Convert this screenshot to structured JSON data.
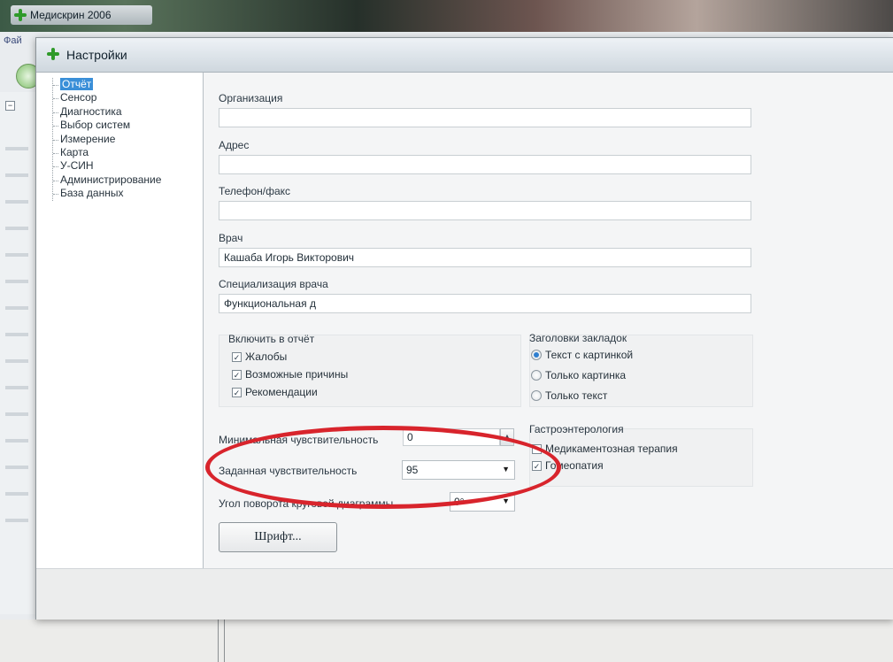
{
  "app": {
    "title": "Медискрин 2006",
    "menu_first": "Фай"
  },
  "dialog": {
    "title": "Настройки"
  },
  "nav": {
    "items": [
      {
        "label": "Отчёт",
        "selected": true
      },
      {
        "label": "Сенсор"
      },
      {
        "label": "Диагностика"
      },
      {
        "label": "Выбор систем"
      },
      {
        "label": "Измерение"
      },
      {
        "label": "Карта"
      },
      {
        "label": "У-СИН"
      },
      {
        "label": "Администрирование"
      },
      {
        "label": "База данных"
      }
    ]
  },
  "form": {
    "organization": {
      "label": "Организация",
      "value": ""
    },
    "address": {
      "label": "Адрес",
      "value": ""
    },
    "phone": {
      "label": "Телефон/факс",
      "value": ""
    },
    "doctor": {
      "label": "Врач",
      "value": "Кашаба Игорь Викторович"
    },
    "specialization": {
      "label": "Специализация врача",
      "value": "Функциональная д"
    }
  },
  "include_group": {
    "title": "Включить в отчёт",
    "items": [
      {
        "label": "Жалобы",
        "checked": true
      },
      {
        "label": "Возможные причины",
        "checked": true
      },
      {
        "label": "Рекомендации",
        "checked": true
      }
    ]
  },
  "tabs_group": {
    "title": "Заголовки закладок",
    "options": [
      {
        "label": "Текст с картинкой",
        "selected": true
      },
      {
        "label": "Только картинка",
        "selected": false
      },
      {
        "label": "Только текст",
        "selected": false
      }
    ]
  },
  "gastro_group": {
    "title": "Гастроэнтерология",
    "items": [
      {
        "label": "Медикаментозная терапия",
        "checked": false
      },
      {
        "label": "Гомеопатия",
        "checked": true
      }
    ]
  },
  "settings": {
    "min_sensitivity": {
      "label": "Минимальная чувствительность",
      "value": "0"
    },
    "set_sensitivity": {
      "label": "Заданная чувствительность",
      "value": "95"
    },
    "rotation": {
      "label": "Угол поворота круговой диаграммы",
      "value": "0°"
    }
  },
  "buttons": {
    "font": "Шрифт..."
  },
  "colors": {
    "selection": "#3a8fd8",
    "annotation": "#d8242c",
    "app_icon": "#2f9a2a"
  }
}
